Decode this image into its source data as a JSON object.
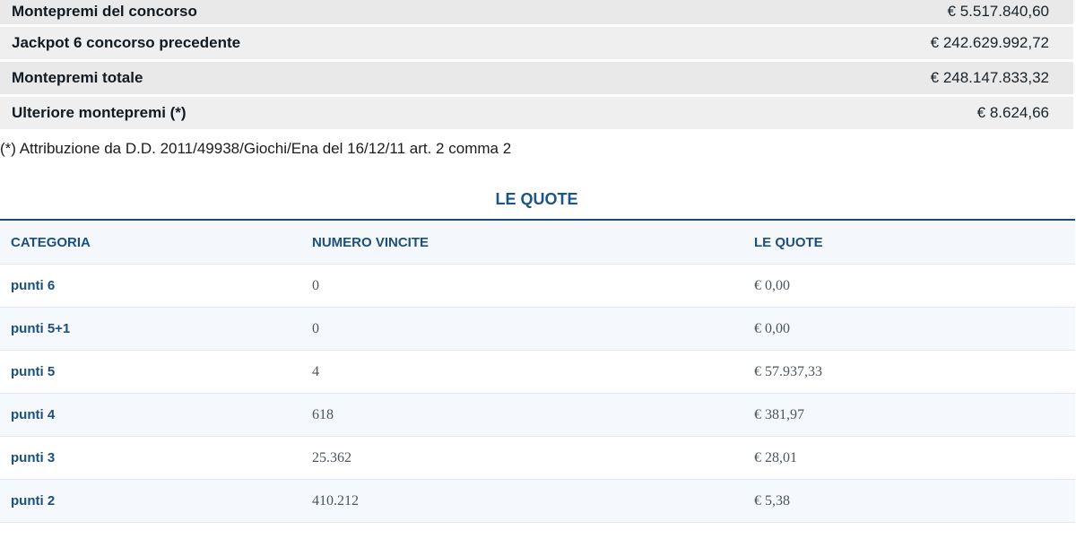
{
  "summary": {
    "rows": [
      {
        "label": "Montepremi del concorso",
        "value": "€ 5.517.840,60"
      },
      {
        "label": "Jackpot 6 concorso precedente",
        "value": "€ 242.629.992,72"
      },
      {
        "label": "Montepremi totale",
        "value": "€ 248.147.833,32"
      },
      {
        "label": "Ulteriore montepremi (*)",
        "value": "€ 8.624,66"
      }
    ],
    "footnote": "(*) Attribuzione da D.D. 2011/49938/Giochi/Ena del 16/12/11 art. 2 comma 2"
  },
  "quote": {
    "title": "LE QUOTE",
    "headers": {
      "categoria": "CATEGORIA",
      "numero_vincite": "NUMERO VINCITE",
      "le_quote": "LE QUOTE"
    },
    "rows": [
      {
        "categoria": "punti 6",
        "vincite": "0",
        "quota": "€ 0,00"
      },
      {
        "categoria": "punti 5+1",
        "vincite": "0",
        "quota": "€ 0,00"
      },
      {
        "categoria": "punti 5",
        "vincite": "4",
        "quota": "€ 57.937,33"
      },
      {
        "categoria": "punti 4",
        "vincite": "618",
        "quota": "€ 381,97"
      },
      {
        "categoria": "punti 3",
        "vincite": "25.362",
        "quota": "€ 28,01"
      },
      {
        "categoria": "punti 2",
        "vincite": "410.212",
        "quota": "€ 5,38"
      }
    ]
  }
}
